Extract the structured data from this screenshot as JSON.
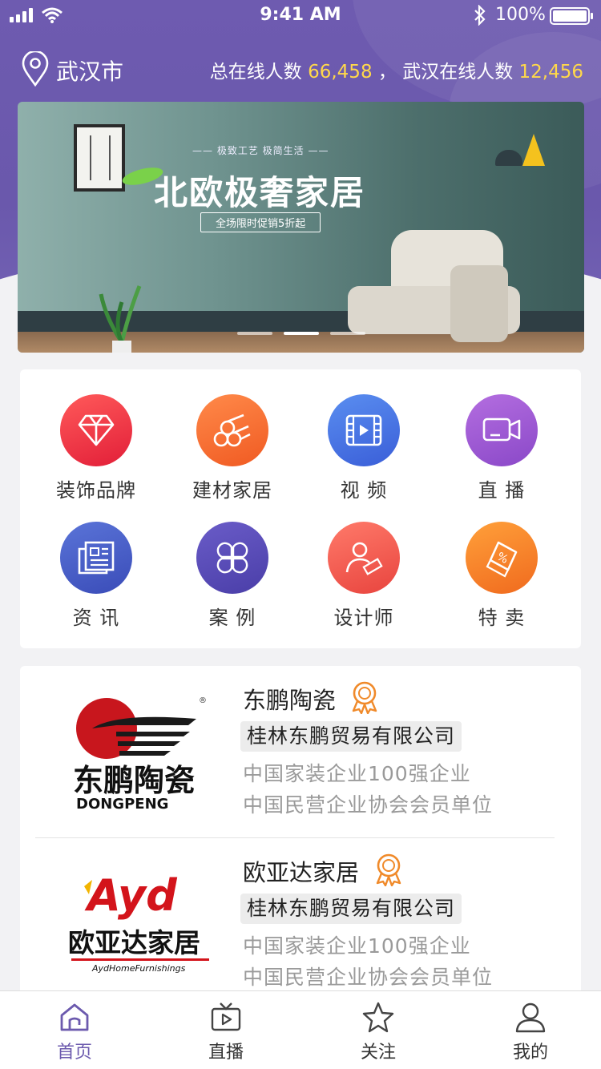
{
  "status_bar": {
    "time": "9:41 AM",
    "battery": "100%"
  },
  "header": {
    "city": "武汉市",
    "online_total_label": "总在线人数",
    "online_total_value": "66,458",
    "separator": "，",
    "online_city_label": "武汉在线人数",
    "online_city_value": "12,456"
  },
  "banner": {
    "subtitle": "—— 极致工艺 极简生活 ——",
    "title": "北欧极奢家居",
    "promo": "全场限时促销5折起",
    "page_count": 3,
    "active_page": 2
  },
  "categories": [
    {
      "label": "装饰品牌",
      "icon": "diamond-icon"
    },
    {
      "label": "建材家居",
      "icon": "pipes-icon"
    },
    {
      "label": "视 频",
      "icon": "film-icon"
    },
    {
      "label": "直 播",
      "icon": "camera-icon"
    },
    {
      "label": "资 讯",
      "icon": "news-icon"
    },
    {
      "label": "案 例",
      "icon": "clover-icon"
    },
    {
      "label": "设计师",
      "icon": "designer-icon"
    },
    {
      "label": "特 卖",
      "icon": "price-tag-icon"
    }
  ],
  "brands": [
    {
      "name": "东鹏陶瓷",
      "company": "桂林东鹏贸易有限公司",
      "tags": [
        "中国家装企业100强企业",
        "中国民营企业协会会员单位"
      ],
      "logo": {
        "cn": "东鹏陶瓷",
        "en": "DONGPENG"
      }
    },
    {
      "name": "欧亚达家居",
      "company": "桂林东鹏贸易有限公司",
      "tags": [
        "中国家装企业100强企业",
        "中国民营企业协会会员单位"
      ],
      "logo": {
        "cn": "欧亚达家居",
        "en": "AydHomeFurnishings",
        "mark": "Ayd"
      }
    }
  ],
  "tabbar": [
    {
      "label": "首页",
      "icon": "home-icon",
      "active": true
    },
    {
      "label": "直播",
      "icon": "tv-icon",
      "active": false
    },
    {
      "label": "关注",
      "icon": "star-icon",
      "active": false
    },
    {
      "label": "我的",
      "icon": "user-icon",
      "active": false
    }
  ],
  "colors": {
    "brand_purple": "#6c5aae",
    "highlight_yellow": "#ffd84a",
    "tag_gray": "#9a9a9a",
    "medal_orange": "#f08a2a"
  }
}
